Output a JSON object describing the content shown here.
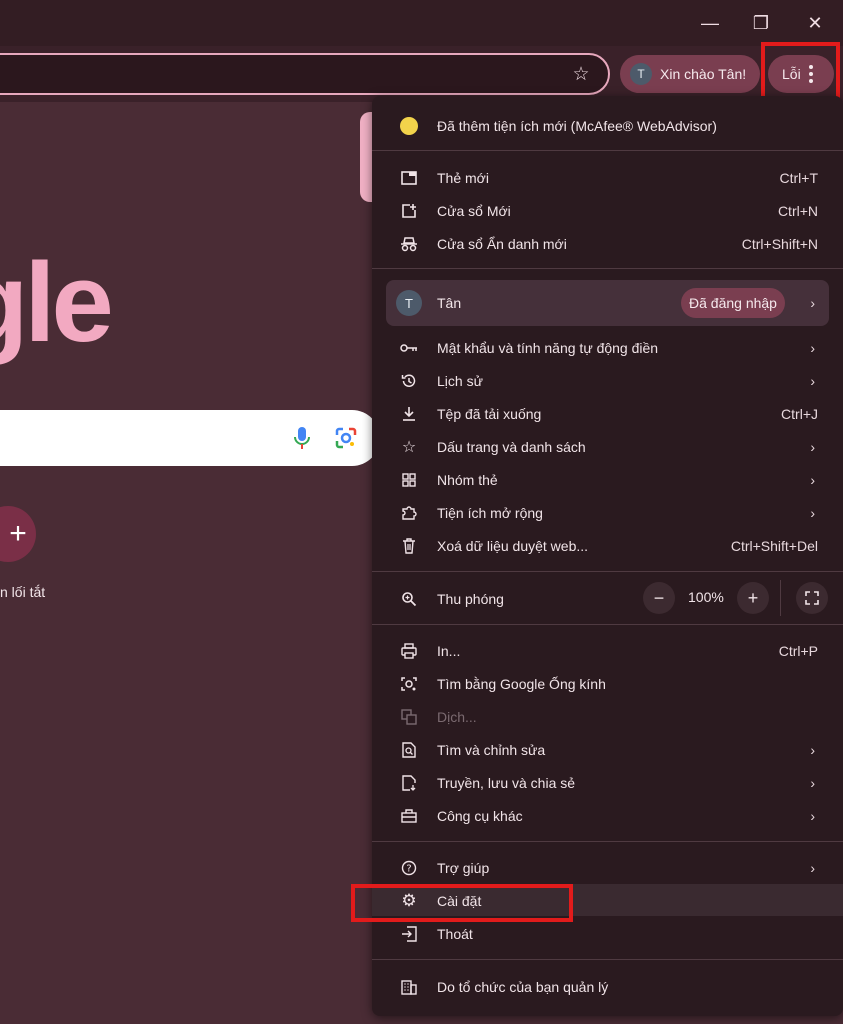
{
  "window": {
    "minimize_glyph": "—",
    "restore_glyph": "❐",
    "close_glyph": "✕"
  },
  "toolbar": {
    "greeting": "Xin chào Tân!",
    "avatar_initial": "T",
    "error_label": "Lỗi"
  },
  "page": {
    "logo_partial": "gle",
    "shortcut_label_partial": "n lối tắt",
    "add_glyph": "+"
  },
  "menu": {
    "extension_notice": "Đã thêm tiện ích mới (McAfee® WebAdvisor)",
    "new_tab": {
      "label": "Thẻ mới",
      "shortcut": "Ctrl+T"
    },
    "new_window": {
      "label": "Cửa sổ Mới",
      "shortcut": "Ctrl+N"
    },
    "incognito": {
      "label": "Cửa sổ Ẩn danh mới",
      "shortcut": "Ctrl+Shift+N"
    },
    "profile": {
      "initial": "T",
      "name": "Tân",
      "status": "Đã đăng nhập"
    },
    "passwords": {
      "label": "Mật khẩu và tính năng tự động điền"
    },
    "history": {
      "label": "Lịch sử"
    },
    "downloads": {
      "label": "Tệp đã tải xuống",
      "shortcut": "Ctrl+J"
    },
    "bookmarks": {
      "label": "Dấu trang và danh sách"
    },
    "tab_groups": {
      "label": "Nhóm thẻ"
    },
    "extensions": {
      "label": "Tiện ích mở rộng"
    },
    "clear_data": {
      "label": "Xoá dữ liệu duyệt web...",
      "shortcut": "Ctrl+Shift+Del"
    },
    "zoom": {
      "label": "Thu phóng",
      "value": "100%",
      "minus": "−",
      "plus": "+"
    },
    "print": {
      "label": "In...",
      "shortcut": "Ctrl+P"
    },
    "lens": {
      "label": "Tìm bằng Google Ống kính"
    },
    "translate": {
      "label": "Dịch..."
    },
    "find_edit": {
      "label": "Tìm và chỉnh sửa"
    },
    "cast_save": {
      "label": "Truyền, lưu và chia sẻ"
    },
    "more_tools": {
      "label": "Công cụ khác"
    },
    "help": {
      "label": "Trợ giúp"
    },
    "settings": {
      "label": "Cài đặt"
    },
    "exit": {
      "label": "Thoát"
    },
    "managed": {
      "label": "Do tổ chức của bạn quản lý"
    },
    "chevron": "›"
  },
  "colors": {
    "highlight_box": "#e21b1b",
    "menu_background": "#2a1a1f",
    "accent_chip": "#7a3e50"
  }
}
